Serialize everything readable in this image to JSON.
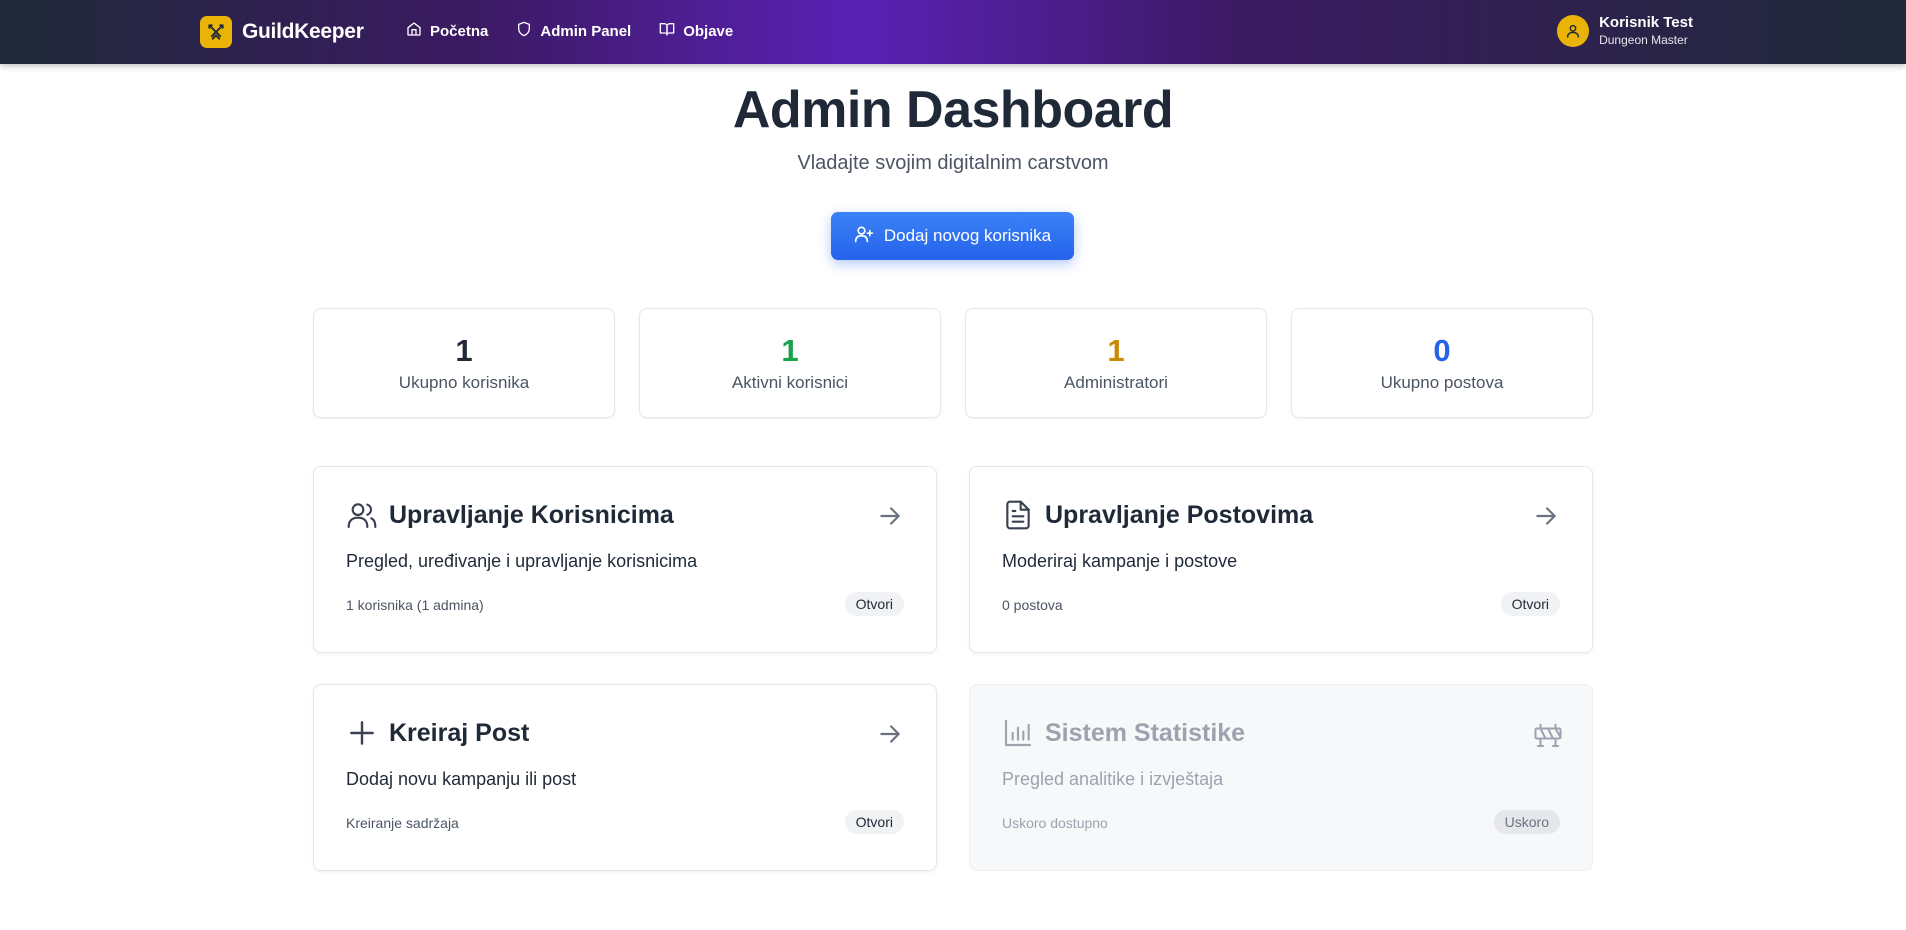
{
  "navbar": {
    "brand": "GuildKeeper",
    "brand_icon": "crossed-swords-icon",
    "links": [
      {
        "label": "Početna",
        "icon": "home-icon"
      },
      {
        "label": "Admin Panel",
        "icon": "shield-icon"
      },
      {
        "label": "Objave",
        "icon": "book-open-icon"
      }
    ],
    "user": {
      "name": "Korisnik Test",
      "role": "Dungeon Master",
      "icon": "user-icon"
    }
  },
  "header": {
    "title": "Admin Dashboard",
    "subtitle": "Vladajte svojim digitalnim carstvom",
    "add_user_label": "Dodaj novog korisnika"
  },
  "stats": [
    {
      "value": "1",
      "label": "Ukupno korisnika",
      "color": "#1f2937"
    },
    {
      "value": "1",
      "label": "Aktivni korisnici",
      "color": "#16a34a"
    },
    {
      "value": "1",
      "label": "Administratori",
      "color": "#ca8a04"
    },
    {
      "value": "0",
      "label": "Ukupno postova",
      "color": "#2563eb"
    }
  ],
  "cards": [
    {
      "title": "Upravljanje Korisnicima",
      "description": "Pregled, uređivanje i upravljanje korisnicima",
      "meta": "1 korisnika (1 admina)",
      "badge": "Otvori",
      "icon": "users-icon"
    },
    {
      "title": "Upravljanje Postovima",
      "description": "Moderiraj kampanje i postove",
      "meta": "0 postova",
      "badge": "Otvori",
      "icon": "file-text-icon"
    },
    {
      "title": "Kreiraj Post",
      "description": "Dodaj novu kampanju ili post",
      "meta": "Kreiranje sadržaja",
      "badge": "Otvori",
      "icon": "plus-icon"
    },
    {
      "title": "Sistem Statistike",
      "description": "Pregled analitike i izvještaja",
      "meta": "Uskoro dostupno",
      "badge": "Uskoro",
      "icon": "bar-chart-icon",
      "disabled": true
    }
  ],
  "colors": {
    "accent": "#2563eb",
    "brand_yellow": "#eab308",
    "nav_purple": "#5b21b6"
  }
}
